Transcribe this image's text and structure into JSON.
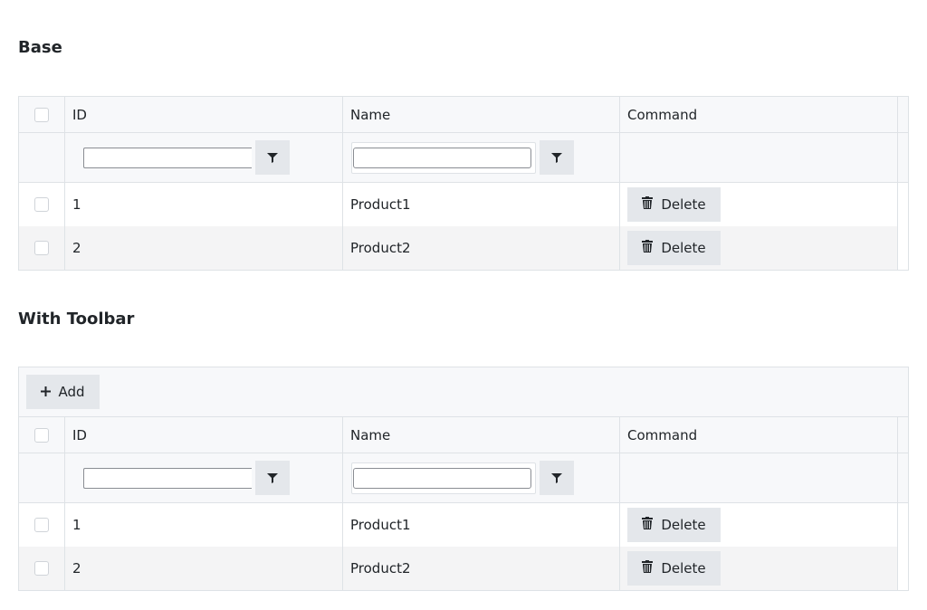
{
  "sections": [
    {
      "title": "Base",
      "toolbar": null
    },
    {
      "title": "With Toolbar",
      "toolbar": {
        "add_label": "Add"
      }
    }
  ],
  "columns": [
    "ID",
    "Name",
    "Command"
  ],
  "rows": [
    {
      "id": "1",
      "name": "Product1"
    },
    {
      "id": "2",
      "name": "Product2"
    }
  ],
  "delete_label": "Delete",
  "icons": {
    "filter": "filter-icon",
    "delete": "trash-icon",
    "add": "plus-icon"
  }
}
